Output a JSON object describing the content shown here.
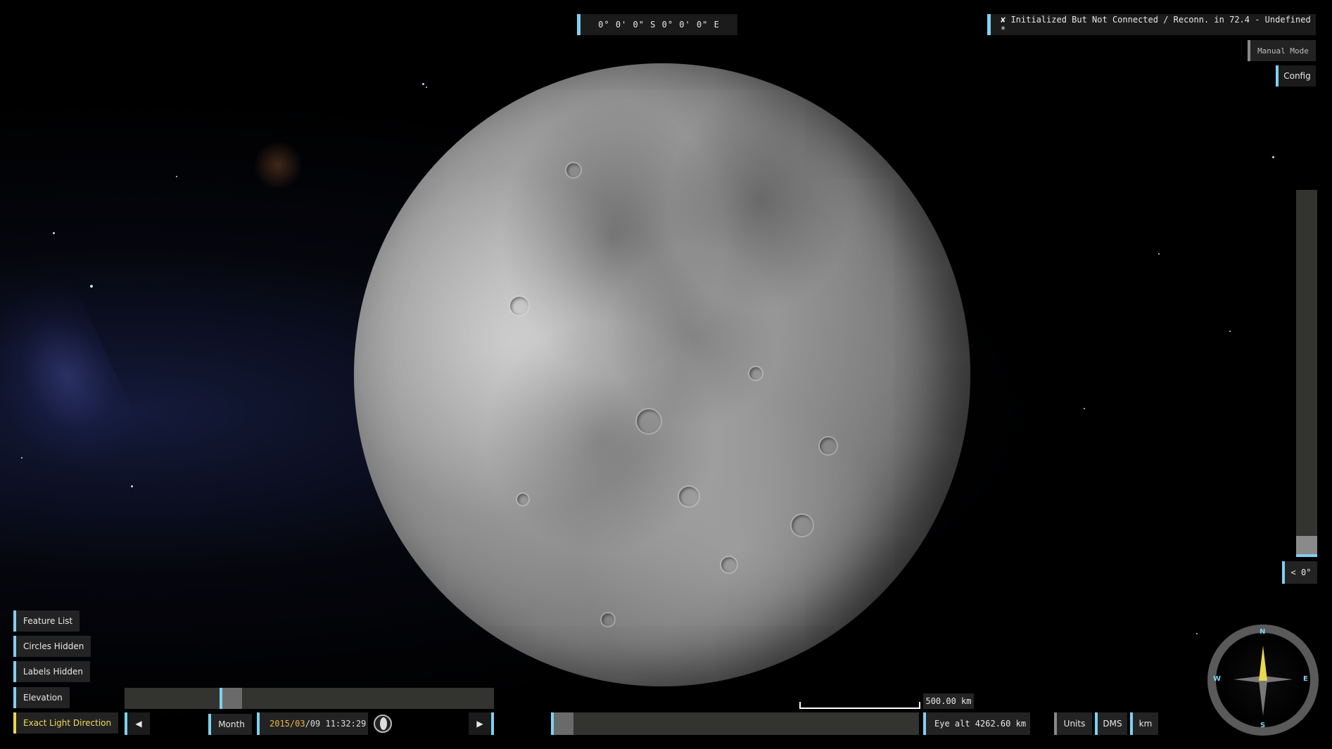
{
  "top": {
    "coords": "0°  0'  0\" S   0°  0'  0\" E",
    "status": "✘  Initialized But Not Connected / Reconn. in 72.4 - Undefined *",
    "manual_mode": "Manual Mode",
    "config": "Config"
  },
  "right": {
    "tilt_label": "< 0°"
  },
  "left_buttons": [
    {
      "label": "Feature List"
    },
    {
      "label": "Circles Hidden"
    },
    {
      "label": "Labels Hidden"
    },
    {
      "label": "Elevation"
    },
    {
      "label": "Exact Light Direction"
    }
  ],
  "time": {
    "prev": "◀",
    "next": "▶",
    "step": "Month",
    "date_year": "2015/03",
    "date_rest": "/09 11:32:29"
  },
  "scale": {
    "label": "500.00 km"
  },
  "eye_alt": "Eye alt 4262.60 km",
  "units": {
    "units_label": "Units",
    "dms_label": "DMS",
    "km_label": "km"
  },
  "compass": {
    "n": "N",
    "s": "S",
    "e": "E",
    "w": "W"
  },
  "colors": {
    "accent": "#7fd0f0",
    "highlight": "#e8d84a"
  }
}
